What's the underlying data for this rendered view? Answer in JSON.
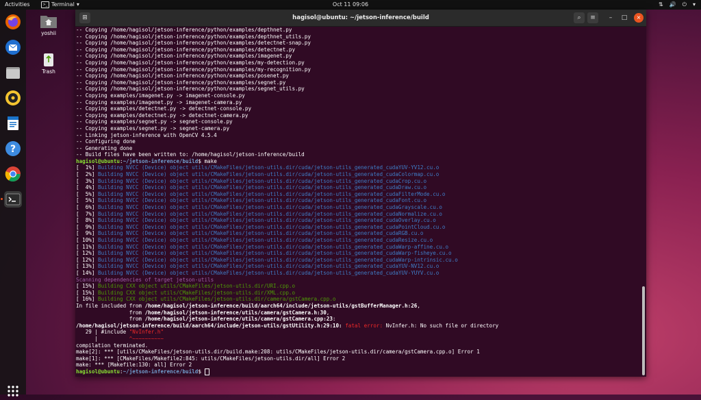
{
  "topbar": {
    "activities": "Activities",
    "app_name": "Terminal",
    "app_arrow": "▾",
    "clock": "Oct 11  09:06",
    "tray_network": "⇅",
    "tray_sound": "🔊",
    "tray_power": "⏻",
    "tray_arrow": "▾"
  },
  "desktop": {
    "home_label": "yoshii",
    "trash_label": "Trash"
  },
  "dock": {
    "items": [
      "firefox",
      "thunderbird",
      "files",
      "rhythmbox",
      "writer",
      "help",
      "chrome",
      "terminal"
    ]
  },
  "window": {
    "title": "hagisol@ubuntu: ~/jetson-inference/build",
    "newtab_icon": "⊞",
    "search_icon": "⌕",
    "menu_icon": "≡",
    "min_icon": "–",
    "max_icon": "□",
    "close_icon": "×"
  },
  "prompt": {
    "user": "hagisol@ubuntu",
    "sep": ":",
    "path": "~/jetson-inference/build",
    "dollar": "$ "
  },
  "terminal": {
    "lines": [
      {
        "c": "white",
        "t": "-- Copying /home/hagisol/jetson-inference/python/examples/depthnet.py"
      },
      {
        "c": "white",
        "t": "-- Copying /home/hagisol/jetson-inference/python/examples/depthnet_utils.py"
      },
      {
        "c": "white",
        "t": "-- Copying /home/hagisol/jetson-inference/python/examples/detectnet-snap.py"
      },
      {
        "c": "white",
        "t": "-- Copying /home/hagisol/jetson-inference/python/examples/detectnet.py"
      },
      {
        "c": "white",
        "t": "-- Copying /home/hagisol/jetson-inference/python/examples/imagenet.py"
      },
      {
        "c": "white",
        "t": "-- Copying /home/hagisol/jetson-inference/python/examples/my-detection.py"
      },
      {
        "c": "white",
        "t": "-- Copying /home/hagisol/jetson-inference/python/examples/my-recognition.py"
      },
      {
        "c": "white",
        "t": "-- Copying /home/hagisol/jetson-inference/python/examples/posenet.py"
      },
      {
        "c": "white",
        "t": "-- Copying /home/hagisol/jetson-inference/python/examples/segnet.py"
      },
      {
        "c": "white",
        "t": "-- Copying /home/hagisol/jetson-inference/python/examples/segnet_utils.py"
      },
      {
        "c": "white",
        "t": "-- Copying examples/imagenet.py -> imagenet-console.py"
      },
      {
        "c": "white",
        "t": "-- Copying examples/imagenet.py -> imagenet-camera.py"
      },
      {
        "c": "white",
        "t": "-- Copying examples/detectnet.py -> detectnet-console.py"
      },
      {
        "c": "white",
        "t": "-- Copying examples/detectnet.py -> detectnet-camera.py"
      },
      {
        "c": "white",
        "t": "-- Copying examples/segnet.py -> segnet-console.py"
      },
      {
        "c": "white",
        "t": "-- Copying examples/segnet.py -> segnet-camera.py"
      },
      {
        "c": "white",
        "t": "-- Linking jetson-inference with OpenCV 4.5.4"
      },
      {
        "c": "white",
        "t": "-- Configuring done"
      },
      {
        "c": "white",
        "t": "-- Generating done"
      },
      {
        "c": "white",
        "t": "-- Build files have been written to: /home/hagisol/jetson-inference/build"
      },
      {
        "c": "prompt",
        "t": "make"
      },
      {
        "c": "pct",
        "p": "[  1%] ",
        "c2": "blue",
        "t": "Building NVCC (Device) object utils/CMakeFiles/jetson-utils.dir/cuda/jetson-utils_generated_cudaYUV-YV12.cu.o"
      },
      {
        "c": "pct",
        "p": "[  2%] ",
        "c2": "blue",
        "t": "Building NVCC (Device) object utils/CMakeFiles/jetson-utils.dir/cuda/jetson-utils_generated_cudaColormap.cu.o"
      },
      {
        "c": "pct",
        "p": "[  3%] ",
        "c2": "blue",
        "t": "Building NVCC (Device) object utils/CMakeFiles/jetson-utils.dir/cuda/jetson-utils_generated_cudaCrop.cu.o"
      },
      {
        "c": "pct",
        "p": "[  4%] ",
        "c2": "blue",
        "t": "Building NVCC (Device) object utils/CMakeFiles/jetson-utils.dir/cuda/jetson-utils_generated_cudaDraw.cu.o"
      },
      {
        "c": "pct",
        "p": "[  5%] ",
        "c2": "blue",
        "t": "Building NVCC (Device) object utils/CMakeFiles/jetson-utils.dir/cuda/jetson-utils_generated_cudaFilterMode.cu.o"
      },
      {
        "c": "pct",
        "p": "[  5%] ",
        "c2": "blue",
        "t": "Building NVCC (Device) object utils/CMakeFiles/jetson-utils.dir/cuda/jetson-utils_generated_cudaFont.cu.o"
      },
      {
        "c": "pct",
        "p": "[  6%] ",
        "c2": "blue",
        "t": "Building NVCC (Device) object utils/CMakeFiles/jetson-utils.dir/cuda/jetson-utils_generated_cudaGrayscale.cu.o"
      },
      {
        "c": "pct",
        "p": "[  7%] ",
        "c2": "blue",
        "t": "Building NVCC (Device) object utils/CMakeFiles/jetson-utils.dir/cuda/jetson-utils_generated_cudaNormalize.cu.o"
      },
      {
        "c": "pct",
        "p": "[  8%] ",
        "c2": "blue",
        "t": "Building NVCC (Device) object utils/CMakeFiles/jetson-utils.dir/cuda/jetson-utils_generated_cudaOverlay.cu.o"
      },
      {
        "c": "pct",
        "p": "[  9%] ",
        "c2": "blue",
        "t": "Building NVCC (Device) object utils/CMakeFiles/jetson-utils.dir/cuda/jetson-utils_generated_cudaPointCloud.cu.o"
      },
      {
        "c": "pct",
        "p": "[  9%] ",
        "c2": "blue",
        "t": "Building NVCC (Device) object utils/CMakeFiles/jetson-utils.dir/cuda/jetson-utils_generated_cudaRGB.cu.o"
      },
      {
        "c": "pct",
        "p": "[ 10%] ",
        "c2": "blue",
        "t": "Building NVCC (Device) object utils/CMakeFiles/jetson-utils.dir/cuda/jetson-utils_generated_cudaResize.cu.o"
      },
      {
        "c": "pct",
        "p": "[ 11%] ",
        "c2": "blue",
        "t": "Building NVCC (Device) object utils/CMakeFiles/jetson-utils.dir/cuda/jetson-utils_generated_cudaWarp-affine.cu.o"
      },
      {
        "c": "pct",
        "p": "[ 12%] ",
        "c2": "blue",
        "t": "Building NVCC (Device) object utils/CMakeFiles/jetson-utils.dir/cuda/jetson-utils_generated_cudaWarp-fisheye.cu.o"
      },
      {
        "c": "pct",
        "p": "[ 12%] ",
        "c2": "blue",
        "t": "Building NVCC (Device) object utils/CMakeFiles/jetson-utils.dir/cuda/jetson-utils_generated_cudaWarp-intrinsic.cu.o"
      },
      {
        "c": "pct",
        "p": "[ 13%] ",
        "c2": "blue",
        "t": "Building NVCC (Device) object utils/CMakeFiles/jetson-utils.dir/cuda/jetson-utils_generated_cudaYUV-NV12.cu.o"
      },
      {
        "c": "pct",
        "p": "[ 14%] ",
        "c2": "blue",
        "t": "Building NVCC (Device) object utils/CMakeFiles/jetson-utils.dir/cuda/jetson-utils_generated_cudaYUV-YUYV.cu.o"
      },
      {
        "c": "magenta",
        "t": "Scanning dependencies of target jetson-utils"
      },
      {
        "c": "pct",
        "p": "[ 15%] ",
        "c2": "green",
        "t": "Building CXX object utils/CMakeFiles/jetson-utils.dir/URI.cpp.o"
      },
      {
        "c": "pct",
        "p": "[ 15%] ",
        "c2": "green",
        "t": "Building CXX object utils/CMakeFiles/jetson-utils.dir/XML.cpp.o"
      },
      {
        "c": "pct",
        "p": "[ 16%] ",
        "c2": "green",
        "t": "Building CXX object utils/CMakeFiles/jetson-utils.dir/camera/gstCamera.cpp.o"
      },
      {
        "c": "mix",
        "parts": [
          [
            "white",
            "In file included from "
          ],
          [
            "bold",
            "/home/hagisol/jetson-inference/build/aarch64/include/jetson-utils/gstBufferManager.h:26"
          ],
          [
            "white",
            ","
          ]
        ]
      },
      {
        "c": "mix",
        "parts": [
          [
            "white",
            "                 from "
          ],
          [
            "bold",
            "/home/hagisol/jetson-inference/utils/camera/gstCamera.h:30"
          ],
          [
            "white",
            ","
          ]
        ]
      },
      {
        "c": "mix",
        "parts": [
          [
            "white",
            "                 from "
          ],
          [
            "bold",
            "/home/hagisol/jetson-inference/utils/camera/gstCamera.cpp:23"
          ],
          [
            "white",
            ":"
          ]
        ]
      },
      {
        "c": "mix",
        "parts": [
          [
            "bold",
            "/home/hagisol/jetson-inference/build/aarch64/include/jetson-utils/gstUtility.h:29:10:"
          ],
          [
            "white",
            " "
          ],
          [
            "red",
            "fatal error: "
          ],
          [
            "white",
            "NvInfer.h: No such file or directory"
          ]
        ]
      },
      {
        "c": "mix",
        "parts": [
          [
            "white",
            "   29 | #include "
          ],
          [
            "red",
            "\"NvInfer.h\""
          ]
        ]
      },
      {
        "c": "mix",
        "parts": [
          [
            "white",
            "      |          "
          ],
          [
            "red",
            "^~~~~~~~~~~"
          ]
        ]
      },
      {
        "c": "white",
        "t": "compilation terminated."
      },
      {
        "c": "white",
        "t": "make[2]: *** [utils/CMakeFiles/jetson-utils.dir/build.make:208: utils/CMakeFiles/jetson-utils.dir/camera/gstCamera.cpp.o] Error 1"
      },
      {
        "c": "white",
        "t": "make[1]: *** [CMakeFiles/Makefile2:845: utils/CMakeFiles/jetson-utils.dir/all] Error 2"
      },
      {
        "c": "white",
        "t": "make: *** [Makefile:130: all] Error 2"
      },
      {
        "c": "prompt",
        "t": ""
      }
    ]
  },
  "colors": {
    "terminal_bg": "#300a24",
    "prompt_user": "#8ae234",
    "prompt_path": "#729fcf",
    "build_blue": "#3f7ec8",
    "build_green": "#4e9a06",
    "error_red": "#ef2929",
    "accent_orange": "#e95420"
  }
}
